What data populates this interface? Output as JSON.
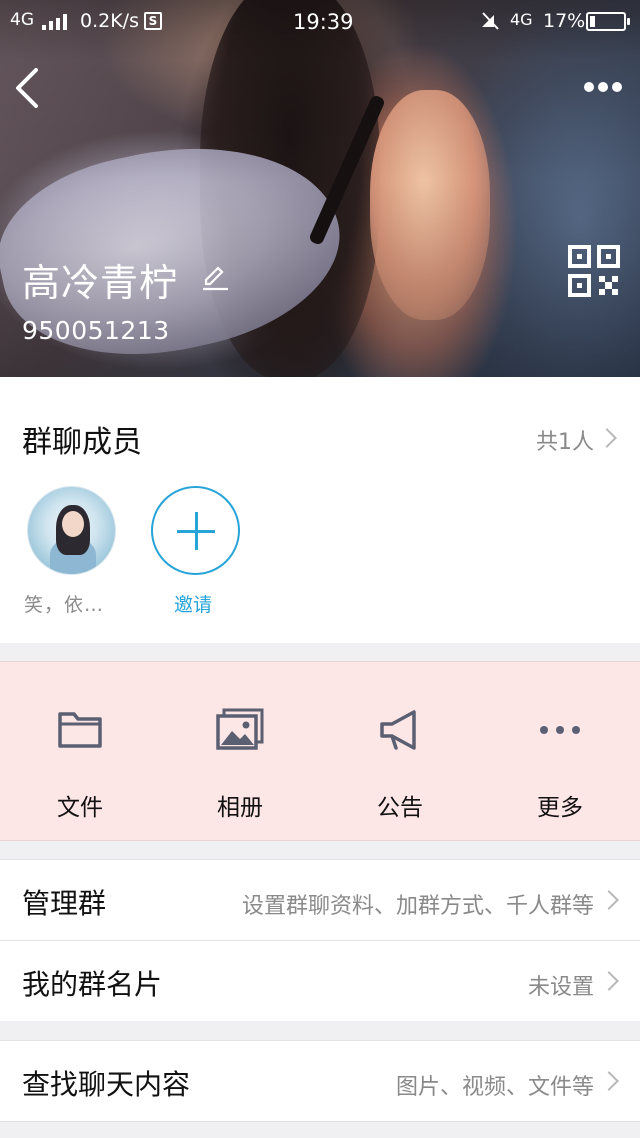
{
  "status_bar": {
    "network": "4G",
    "speed": "0.2K/s",
    "sim_badge": "S",
    "time": "19:39",
    "network2": "4G",
    "battery_percent": "17%",
    "battery_level": 0.17
  },
  "header": {
    "group_name": "高冷青柠",
    "group_id": "950051213",
    "icons": [
      "back-arrow-icon",
      "more-dots-icon",
      "edit-pencil-icon",
      "qr-code-icon"
    ]
  },
  "members": {
    "title": "群聊成员",
    "count": "共1人",
    "list": [
      {
        "name": "笑，依…"
      }
    ],
    "invite_label": "邀请"
  },
  "actions": [
    {
      "label": "文件",
      "icon": "folder-icon"
    },
    {
      "label": "相册",
      "icon": "album-icon"
    },
    {
      "label": "公告",
      "icon": "megaphone-icon"
    },
    {
      "label": "更多",
      "icon": "more-dots-icon"
    }
  ],
  "rows": {
    "manage": {
      "title": "管理群",
      "value": "设置群聊资料、加群方式、千人群等"
    },
    "card": {
      "title": "我的群名片",
      "value": "未设置"
    },
    "search": {
      "title": "查找聊天内容",
      "value": "图片、视频、文件等"
    }
  },
  "colors": {
    "accent": "#27a4d8",
    "action_bg": "#fde6e6",
    "icon_gray": "#5b5f72"
  }
}
